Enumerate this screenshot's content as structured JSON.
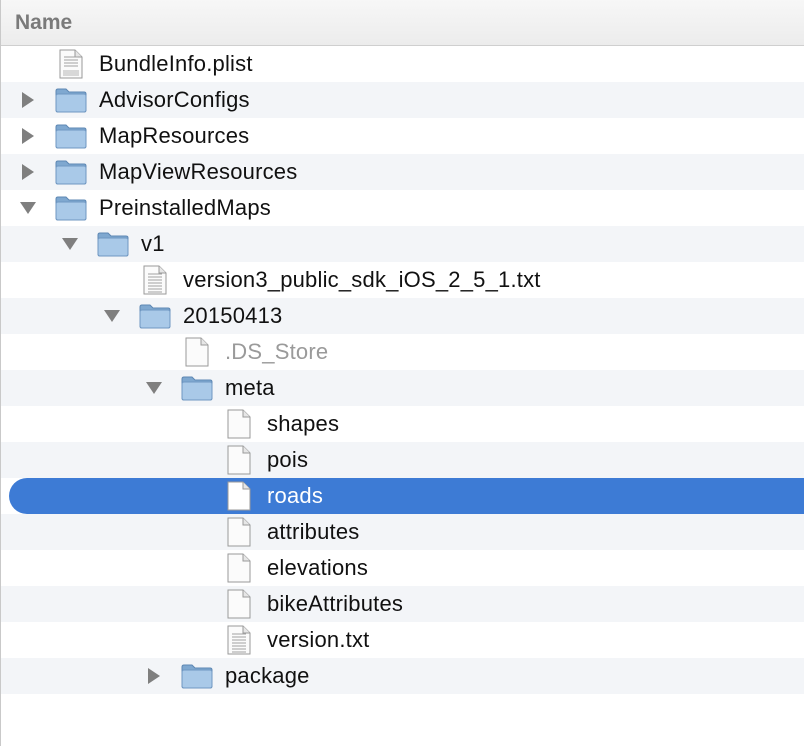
{
  "header": {
    "name_label": "Name"
  },
  "colors": {
    "selection": "#3d7bd5",
    "folder": "#8fb4d8",
    "disclosure": "#7f7f7f"
  },
  "rows": [
    {
      "label": "BundleInfo.plist",
      "icon": "plist-file-icon",
      "level": 0,
      "disclosure": "none"
    },
    {
      "label": "AdvisorConfigs",
      "icon": "folder-icon",
      "level": 0,
      "disclosure": "collapsed"
    },
    {
      "label": "MapResources",
      "icon": "folder-icon",
      "level": 0,
      "disclosure": "collapsed"
    },
    {
      "label": "MapViewResources",
      "icon": "folder-icon",
      "level": 0,
      "disclosure": "collapsed"
    },
    {
      "label": "PreinstalledMaps",
      "icon": "folder-icon",
      "level": 0,
      "disclosure": "expanded"
    },
    {
      "label": "v1",
      "icon": "folder-icon",
      "level": 1,
      "disclosure": "expanded"
    },
    {
      "label": "version3_public_sdk_iOS_2_5_1.txt",
      "icon": "text-file-icon",
      "level": 2,
      "disclosure": "none"
    },
    {
      "label": "20150413",
      "icon": "folder-icon",
      "level": 2,
      "disclosure": "expanded"
    },
    {
      "label": ".DS_Store",
      "icon": "blank-file-icon",
      "level": 3,
      "disclosure": "none",
      "dim": true
    },
    {
      "label": "meta",
      "icon": "folder-icon",
      "level": 3,
      "disclosure": "expanded"
    },
    {
      "label": "shapes",
      "icon": "blank-file-icon",
      "level": 4,
      "disclosure": "none"
    },
    {
      "label": "pois",
      "icon": "blank-file-icon",
      "level": 4,
      "disclosure": "none"
    },
    {
      "label": "roads",
      "icon": "blank-file-icon",
      "level": 4,
      "disclosure": "none",
      "selected": true
    },
    {
      "label": "attributes",
      "icon": "blank-file-icon",
      "level": 4,
      "disclosure": "none"
    },
    {
      "label": "elevations",
      "icon": "blank-file-icon",
      "level": 4,
      "disclosure": "none"
    },
    {
      "label": "bikeAttributes",
      "icon": "blank-file-icon",
      "level": 4,
      "disclosure": "none"
    },
    {
      "label": "version.txt",
      "icon": "text-file-icon",
      "level": 4,
      "disclosure": "none"
    },
    {
      "label": "package",
      "icon": "folder-icon",
      "level": 3,
      "disclosure": "collapsed"
    }
  ]
}
